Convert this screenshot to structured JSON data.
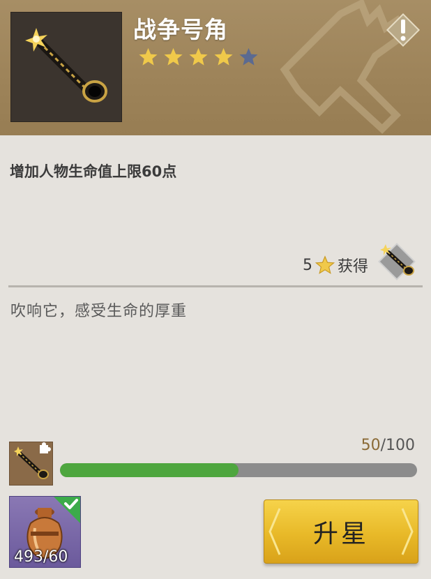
{
  "item": {
    "name": "战争号角",
    "stars_total": 5,
    "stars_filled": 4,
    "icon": "war-horn-icon"
  },
  "effect": {
    "description": "增加人物生命值上限60点"
  },
  "obtain": {
    "star_requirement": "5",
    "label": "获得",
    "icon": "war-horn-icon"
  },
  "flavor_text": "吹响它，感受生命的厚重",
  "fragments": {
    "current": "50",
    "separator": "/",
    "required": "100",
    "progress_fraction": 0.5,
    "icon": "horn-fragment-icon"
  },
  "material": {
    "count": "493/60",
    "icon": "bronze-jar-icon",
    "sufficient": true
  },
  "actions": {
    "upgrade_label": "升星"
  },
  "colors": {
    "header": "#9d8359",
    "star_filled": "#f0c94a",
    "star_empty": "#5b6a91",
    "progress": "#4ea63e",
    "button": "#e8b928"
  }
}
